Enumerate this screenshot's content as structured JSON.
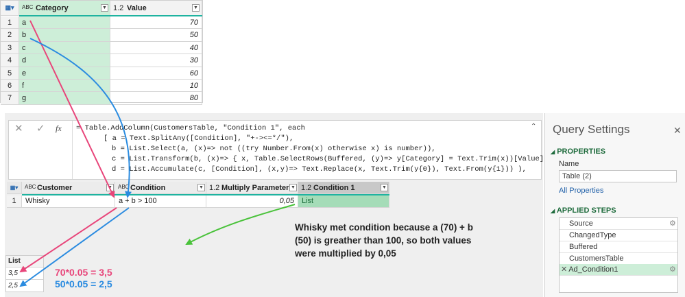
{
  "top_table": {
    "col1_label": "Category",
    "col2_label": "Value",
    "col1_type": "ABC",
    "col2_type": "1.2",
    "rows": [
      {
        "num": "1",
        "category": "a",
        "value": "70"
      },
      {
        "num": "2",
        "category": "b",
        "value": "50"
      },
      {
        "num": "3",
        "category": "c",
        "value": "40"
      },
      {
        "num": "4",
        "category": "d",
        "value": "30"
      },
      {
        "num": "5",
        "category": "e",
        "value": "60"
      },
      {
        "num": "6",
        "category": "f",
        "value": "10"
      },
      {
        "num": "7",
        "category": "g",
        "value": "80"
      }
    ]
  },
  "formula_bar": {
    "fx": "fx",
    "line1": "= Table.AddColumn(CustomersTable, \"Condition 1\", each",
    "line2": "[ a = Text.SplitAny([Condition], \"+-><=*/\"),",
    "line3": "b = List.Select(a, (x)=> not ((try Number.From(x) otherwise x) is number)),",
    "line4": "c = List.Transform(b, (x)=> { x, Table.SelectRows(Buffered, (y)=> y[Category] = Text.Trim(x))[Value]{0}? }),",
    "line5": "d = List.Accumulate(c, [Condition], (x,y)=> Text.Replace(x, Text.Trim(y{0}), Text.From(y{1})) ),"
  },
  "main_table": {
    "headers": [
      {
        "type": "ABC",
        "label": "Customer"
      },
      {
        "type": "ABC",
        "label": "Condition"
      },
      {
        "type": "1.2",
        "label": "Multiply Parameter"
      },
      {
        "type": "1.2",
        "label": "Condition 1"
      }
    ],
    "row": {
      "num": "1",
      "customer": "Whisky",
      "condition": "a + b > 100",
      "multiply": "0,05",
      "condition1": "List"
    }
  },
  "annotation": {
    "line1": "Whisky met condition because a (70) + b",
    "line2": "(50) is greather than 100, so both values",
    "line3": "were multiplied by 0,05"
  },
  "list_table": {
    "header": "List",
    "values": [
      "3,5",
      "2,5"
    ]
  },
  "calcs": {
    "pink": "70*0.05 = 3,5",
    "blue": "50*0.05 = 2,5"
  },
  "query_settings": {
    "title": "Query Settings",
    "properties_label": "PROPERTIES",
    "name_label": "Name",
    "name_value": "Table (2)",
    "all_properties": "All Properties",
    "applied_steps_label": "APPLIED STEPS",
    "steps": [
      "Source",
      "ChangedType",
      "Buffered",
      "CustomersTable",
      "Ad_Condition1"
    ]
  },
  "colors": {
    "pink": "#e8457a",
    "blue": "#2a8be0",
    "green": "#49c23a",
    "teal": "#1fb3a0",
    "selected_col": "#a5dcb8"
  }
}
